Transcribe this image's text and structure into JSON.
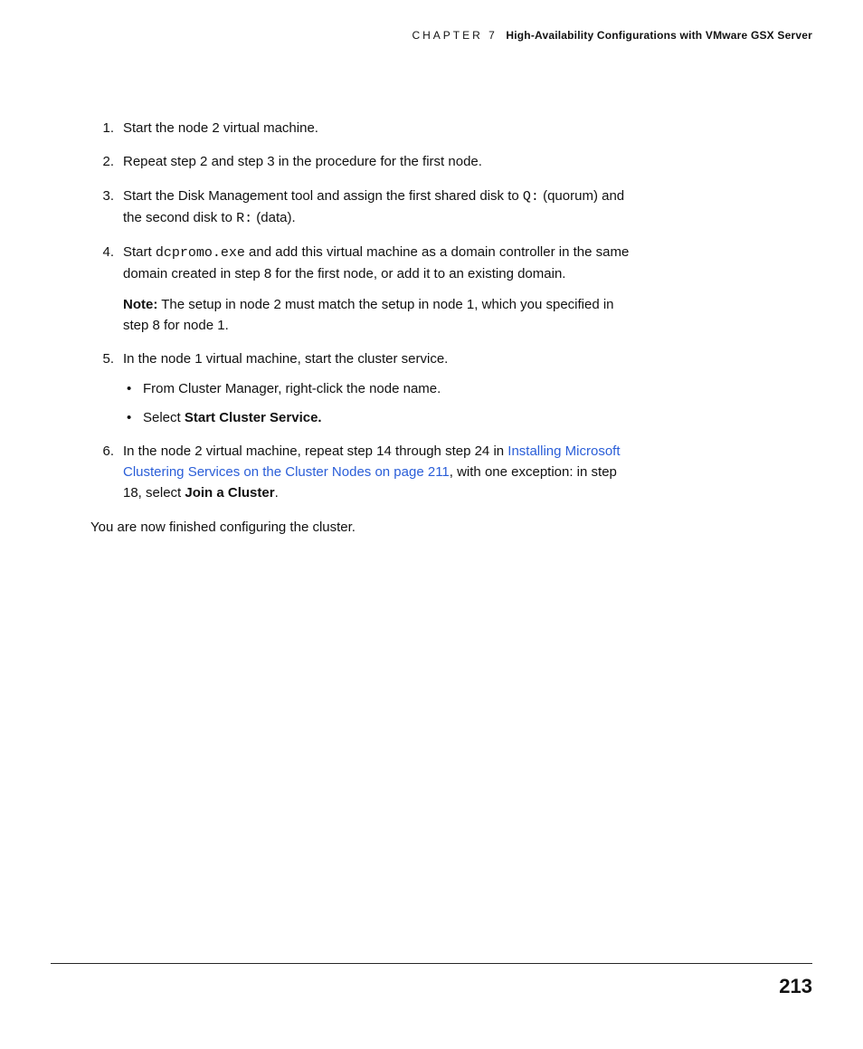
{
  "header": {
    "chapter_prefix": "CHAPTER 7",
    "title": "High-Availability Configurations with VMware GSX Server"
  },
  "steps": [
    {
      "num": "1.",
      "text": "Start the node 2 virtual machine."
    },
    {
      "num": "2.",
      "text": "Repeat step 2 and step 3 in the procedure for the first node."
    },
    {
      "num": "3.",
      "pre": "Start the Disk Management tool and assign the first shared disk to ",
      "code1": "Q:",
      "mid": " (quorum) and the second disk to ",
      "code2": "R:",
      "post": " (data)."
    },
    {
      "num": "4.",
      "pre": "Start ",
      "code": "dcpromo.exe",
      "post": " and add this virtual machine as a domain controller in the same domain created in step 8 for the first node, or add it to an existing domain.",
      "note_label": "Note:",
      "note_text": "  The setup in node 2 must match the setup in node 1, which you specified in step 8 for node 1."
    },
    {
      "num": "5.",
      "text": "In the node 1 virtual machine, start the cluster service.",
      "sub": [
        {
          "text": "From Cluster Manager, right-click the node name."
        },
        {
          "pre": "Select ",
          "bold": "Start Cluster Service."
        }
      ]
    },
    {
      "num": "6.",
      "pre": "In the node 2 virtual machine, repeat step 14 through step 24 in ",
      "link": "Installing Microsoft Clustering Services on the Cluster Nodes on page 211",
      "mid2": ", with one exception: in step 18, select ",
      "bold": "Join a Cluster",
      "post": "."
    }
  ],
  "closing": "You are now finished configuring the cluster.",
  "page_number": "213"
}
